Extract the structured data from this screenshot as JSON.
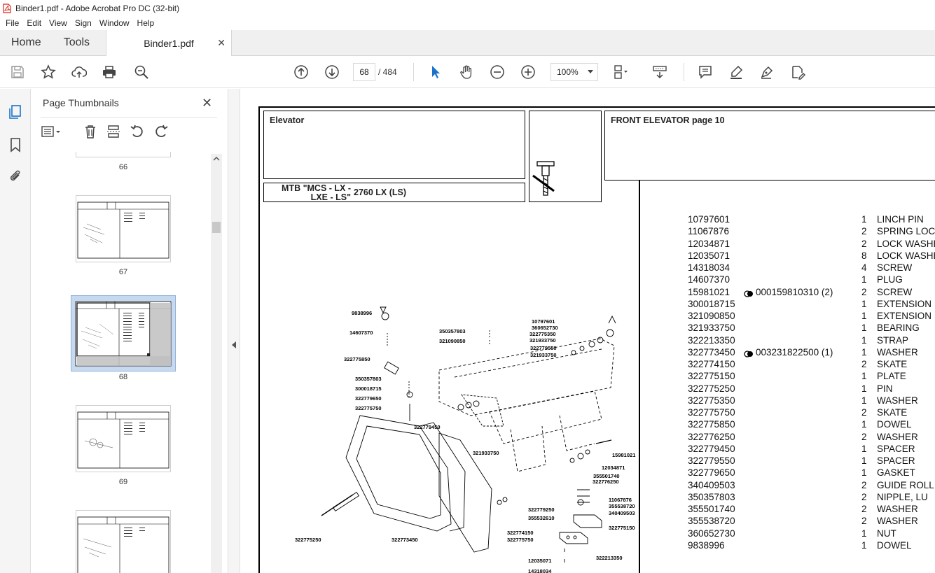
{
  "window": {
    "title": "Binder1.pdf - Adobe Acrobat Pro DC (32-bit)"
  },
  "menu": [
    "File",
    "Edit",
    "View",
    "Sign",
    "Window",
    "Help"
  ],
  "tabs": {
    "home": "Home",
    "tools": "Tools",
    "document": "Binder1.pdf"
  },
  "toolbar": {
    "page_current": "68",
    "page_total": "/ 484",
    "zoom": "100%"
  },
  "thumbnails_panel": {
    "title": "Page Thumbnails",
    "pages": [
      "66",
      "67",
      "68",
      "69"
    ],
    "selected": "68"
  },
  "document": {
    "section": "Elevator",
    "model": "MTB \"MCS - LX -\n LXE - LS\"",
    "model_variant": "2760 LX (LS)",
    "heading": "FRONT ELEVATOR  page 10",
    "parts": [
      {
        "pn": "10797601",
        "alt": "",
        "qty": "1",
        "desc": "LINCH PIN"
      },
      {
        "pn": "11067876",
        "alt": "",
        "qty": "2",
        "desc": "SPRING LOC"
      },
      {
        "pn": "12034871",
        "alt": "",
        "qty": "2",
        "desc": "LOCK WASHE"
      },
      {
        "pn": "12035071",
        "alt": "",
        "qty": "8",
        "desc": "LOCK WASHE"
      },
      {
        "pn": "14318034",
        "alt": "",
        "qty": "4",
        "desc": "SCREW"
      },
      {
        "pn": "14607370",
        "alt": "",
        "qty": "1",
        "desc": "PLUG"
      },
      {
        "pn": "15981021",
        "alt": "000159810310  (2)",
        "qty": "2",
        "desc": "SCREW"
      },
      {
        "pn": "300018715",
        "alt": "",
        "qty": "1",
        "desc": "EXTENSION"
      },
      {
        "pn": "321090850",
        "alt": "",
        "qty": "1",
        "desc": "EXTENSION"
      },
      {
        "pn": "321933750",
        "alt": "",
        "qty": "1",
        "desc": "BEARING"
      },
      {
        "pn": "322213350",
        "alt": "",
        "qty": "1",
        "desc": "STRAP"
      },
      {
        "pn": "322773450",
        "alt": "003231822500  (1)",
        "qty": "1",
        "desc": "WASHER"
      },
      {
        "pn": "322774150",
        "alt": "",
        "qty": "2",
        "desc": "SKATE"
      },
      {
        "pn": "322775150",
        "alt": "",
        "qty": "1",
        "desc": "PLATE"
      },
      {
        "pn": "322775250",
        "alt": "",
        "qty": "1",
        "desc": "PIN"
      },
      {
        "pn": "322775350",
        "alt": "",
        "qty": "1",
        "desc": "WASHER"
      },
      {
        "pn": "322775750",
        "alt": "",
        "qty": "2",
        "desc": "SKATE"
      },
      {
        "pn": "322775850",
        "alt": "",
        "qty": "1",
        "desc": "DOWEL"
      },
      {
        "pn": "322776250",
        "alt": "",
        "qty": "2",
        "desc": "WASHER"
      },
      {
        "pn": "322779450",
        "alt": "",
        "qty": "1",
        "desc": "SPACER"
      },
      {
        "pn": "322779550",
        "alt": "",
        "qty": "1",
        "desc": "SPACER"
      },
      {
        "pn": "322779650",
        "alt": "",
        "qty": "1",
        "desc": "GASKET"
      },
      {
        "pn": "340409503",
        "alt": "",
        "qty": "2",
        "desc": "GUIDE ROLL"
      },
      {
        "pn": "350357803",
        "alt": "",
        "qty": "2",
        "desc": "NIPPLE, LU"
      },
      {
        "pn": "355501740",
        "alt": "",
        "qty": "2",
        "desc": "WASHER"
      },
      {
        "pn": "355538720",
        "alt": "",
        "qty": "2",
        "desc": "WASHER"
      },
      {
        "pn": "360652730",
        "alt": "",
        "qty": "1",
        "desc": "NUT"
      },
      {
        "pn": "9838996",
        "alt": "",
        "qty": "1",
        "desc": "DOWEL"
      }
    ],
    "diagram_labels": [
      "9838996",
      "14607370",
      "322775850",
      "350357803",
      "300018715",
      "322779650",
      "322775750",
      "350357803",
      "321090850",
      "322779450",
      "321933750",
      "10797601",
      "360652730",
      "322775350",
      "321933750",
      "322779550",
      "321933750",
      "15981021",
      "12034871",
      "355501740",
      "322776250",
      "11067876",
      "355538720",
      "340409503",
      "322779250",
      "355532610",
      "322775150",
      "322774150",
      "322775750",
      "322775250",
      "322773450",
      "12035071",
      "322213350",
      "14318034"
    ]
  },
  "colors": {
    "accent": "#1a73c9",
    "acrobat_red": "#d9261c",
    "selected_thumb": "#c7d9ee"
  }
}
